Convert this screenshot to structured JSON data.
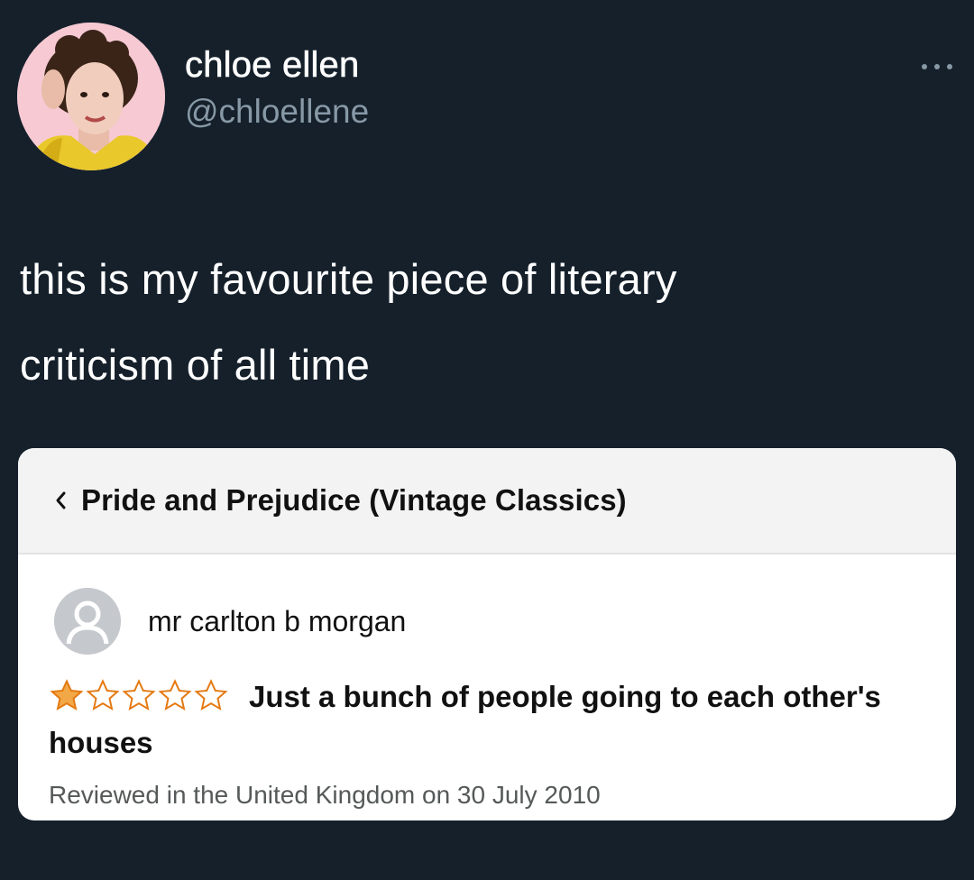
{
  "user": {
    "display_name": "chloe ellen",
    "handle": "@chloellene"
  },
  "tweet": {
    "text_lines": [
      "this is my favourite piece of literary",
      "criticism of all time"
    ]
  },
  "review_card": {
    "book_title": "Pride and Prejudice (Vintage Classics)",
    "reviewer_name": "mr carlton b morgan",
    "rating": 1,
    "rating_max": 5,
    "review_title": "Just a bunch of people going to each other's houses",
    "review_meta": "Reviewed in the United Kingdom on 30 July 2010"
  },
  "icons": {
    "more": "more-horizontal-icon",
    "back": "chevron-left-icon",
    "reviewer_avatar": "default-user-icon",
    "star": "star-icon"
  },
  "colors": {
    "background": "#15202b",
    "secondary_text": "#8899a6",
    "star_fill": "#f3a847",
    "star_outline": "#e47911"
  }
}
